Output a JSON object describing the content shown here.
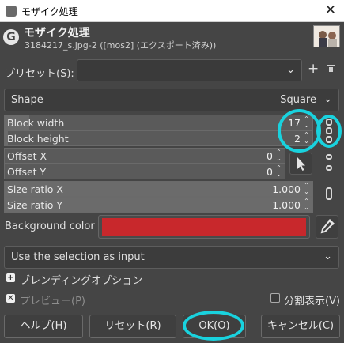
{
  "window": {
    "title": "モザイク処理"
  },
  "header": {
    "title": "モザイク処理",
    "subtitle": "3184217_s.jpg-2 ([mos2] (エクスポート済み))"
  },
  "presets": {
    "label": "プリセット(S):",
    "value": ""
  },
  "shape": {
    "label": "Shape",
    "value": "Square"
  },
  "params": [
    {
      "label": "Block width",
      "value": "17",
      "fraction": 0.08
    },
    {
      "label": "Block height",
      "value": "2",
      "fraction": 0.01
    },
    {
      "label": "Offset X",
      "value": "0",
      "fraction": 0.0
    },
    {
      "label": "Offset Y",
      "value": "0",
      "fraction": 0.0
    },
    {
      "label": "Size ratio X",
      "value": "1.000",
      "fraction": 1.0
    },
    {
      "label": "Size ratio Y",
      "value": "1.000",
      "fraction": 1.0
    }
  ],
  "background": {
    "label": "Background color",
    "color": "#c8282c"
  },
  "selection": {
    "label": "Use the selection as input"
  },
  "blending": {
    "label": "ブレンディングオプション"
  },
  "preview": {
    "label": "プレビュー(P)"
  },
  "split": {
    "label": "分割表示(V)"
  },
  "buttons": {
    "help": "ヘルプ(H)",
    "reset": "リセット(R)",
    "ok": "OK(O)",
    "cancel": "キャンセル(C)"
  },
  "annotation_color": "#19d2de"
}
